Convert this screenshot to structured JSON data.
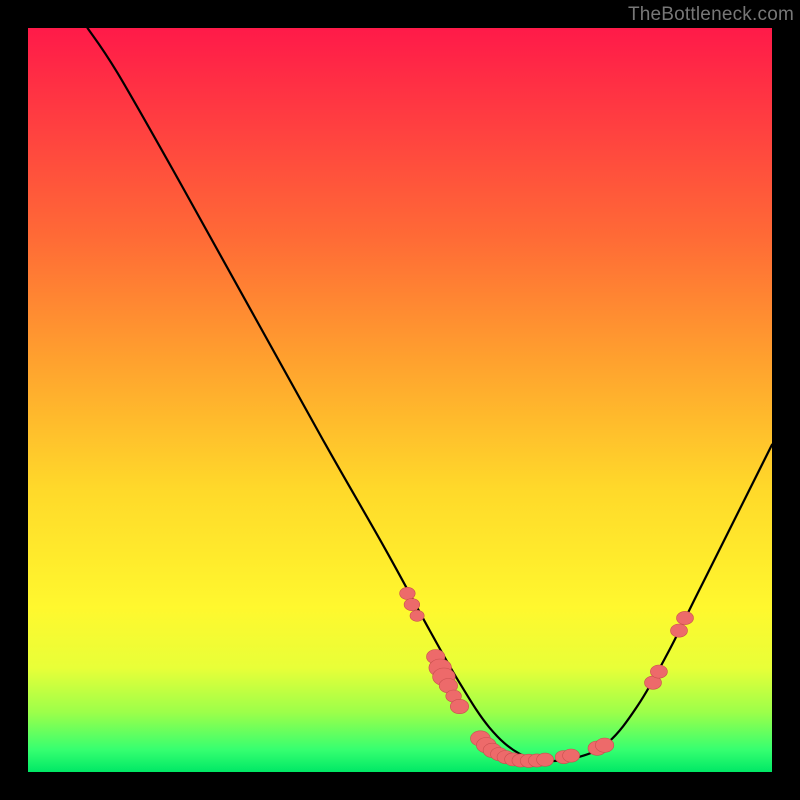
{
  "watermark": "TheBottleneck.com",
  "colors": {
    "dot_fill": "#ed6a6a",
    "dot_stroke": "#c94f4f",
    "curve_stroke": "#000000"
  },
  "chart_data": {
    "type": "line",
    "title": "",
    "xlabel": "",
    "ylabel": "",
    "xlim": [
      0,
      100
    ],
    "ylim": [
      0,
      100
    ],
    "curve": [
      {
        "x": 8,
        "y": 100
      },
      {
        "x": 12,
        "y": 94
      },
      {
        "x": 20,
        "y": 80
      },
      {
        "x": 30,
        "y": 62
      },
      {
        "x": 40,
        "y": 44
      },
      {
        "x": 48,
        "y": 30
      },
      {
        "x": 54,
        "y": 19
      },
      {
        "x": 58,
        "y": 12
      },
      {
        "x": 62,
        "y": 6
      },
      {
        "x": 66,
        "y": 2.5
      },
      {
        "x": 70,
        "y": 1.5
      },
      {
        "x": 74,
        "y": 2
      },
      {
        "x": 78,
        "y": 4
      },
      {
        "x": 82,
        "y": 9
      },
      {
        "x": 86,
        "y": 16
      },
      {
        "x": 90,
        "y": 24
      },
      {
        "x": 95,
        "y": 34
      },
      {
        "x": 100,
        "y": 44
      }
    ],
    "dots": [
      {
        "x": 51.0,
        "y": 24.0,
        "r": 1.1
      },
      {
        "x": 51.6,
        "y": 22.5,
        "r": 1.1
      },
      {
        "x": 52.3,
        "y": 21.0,
        "r": 1.0
      },
      {
        "x": 54.8,
        "y": 15.5,
        "r": 1.3
      },
      {
        "x": 55.4,
        "y": 14.0,
        "r": 1.6
      },
      {
        "x": 55.9,
        "y": 12.8,
        "r": 1.6
      },
      {
        "x": 56.5,
        "y": 11.6,
        "r": 1.3
      },
      {
        "x": 57.2,
        "y": 10.2,
        "r": 1.1
      },
      {
        "x": 58.0,
        "y": 8.8,
        "r": 1.3
      },
      {
        "x": 60.8,
        "y": 4.5,
        "r": 1.4
      },
      {
        "x": 61.6,
        "y": 3.6,
        "r": 1.4
      },
      {
        "x": 62.4,
        "y": 2.9,
        "r": 1.3
      },
      {
        "x": 63.3,
        "y": 2.4,
        "r": 1.2
      },
      {
        "x": 64.2,
        "y": 2.0,
        "r": 1.2
      },
      {
        "x": 65.2,
        "y": 1.7,
        "r": 1.2
      },
      {
        "x": 66.2,
        "y": 1.55,
        "r": 1.2
      },
      {
        "x": 67.3,
        "y": 1.5,
        "r": 1.2
      },
      {
        "x": 68.4,
        "y": 1.55,
        "r": 1.2
      },
      {
        "x": 69.5,
        "y": 1.65,
        "r": 1.2
      },
      {
        "x": 72.0,
        "y": 2.0,
        "r": 1.2
      },
      {
        "x": 73.0,
        "y": 2.2,
        "r": 1.2
      },
      {
        "x": 76.5,
        "y": 3.2,
        "r": 1.3
      },
      {
        "x": 77.5,
        "y": 3.6,
        "r": 1.3
      },
      {
        "x": 84.0,
        "y": 12.0,
        "r": 1.2
      },
      {
        "x": 84.8,
        "y": 13.5,
        "r": 1.2
      },
      {
        "x": 87.5,
        "y": 19.0,
        "r": 1.2
      },
      {
        "x": 88.3,
        "y": 20.7,
        "r": 1.2
      }
    ]
  }
}
